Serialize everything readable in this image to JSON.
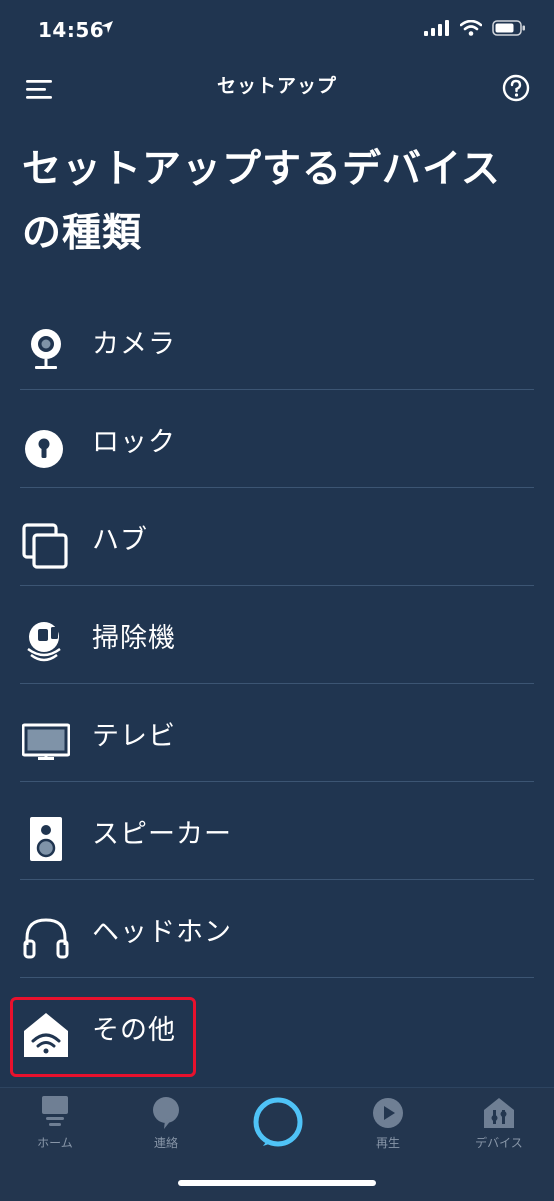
{
  "status": {
    "time": "14:56"
  },
  "nav": {
    "title": "セットアップ"
  },
  "page": {
    "title": "セットアップするデバイスの種類"
  },
  "devices": [
    {
      "label": "カメラ",
      "icon": "camera-icon"
    },
    {
      "label": "ロック",
      "icon": "lock-icon"
    },
    {
      "label": "ハブ",
      "icon": "hub-icon"
    },
    {
      "label": "掃除機",
      "icon": "vacuum-icon"
    },
    {
      "label": "テレビ",
      "icon": "tv-icon"
    },
    {
      "label": "スピーカー",
      "icon": "speaker-icon"
    },
    {
      "label": "ヘッドホン",
      "icon": "headphones-icon"
    },
    {
      "label": "その他",
      "icon": "smart-home-icon"
    }
  ],
  "tabs": [
    {
      "label": "ホーム",
      "icon": "home-icon"
    },
    {
      "label": "連絡",
      "icon": "chat-icon"
    },
    {
      "label": "",
      "icon": "alexa-icon"
    },
    {
      "label": "再生",
      "icon": "play-icon"
    },
    {
      "label": "デバイス",
      "icon": "devices-icon"
    }
  ],
  "colors": {
    "background": "#203550",
    "highlight": "#e8112d",
    "alexa": "#4fc3f7",
    "tab_inactive": "#8896a8"
  }
}
